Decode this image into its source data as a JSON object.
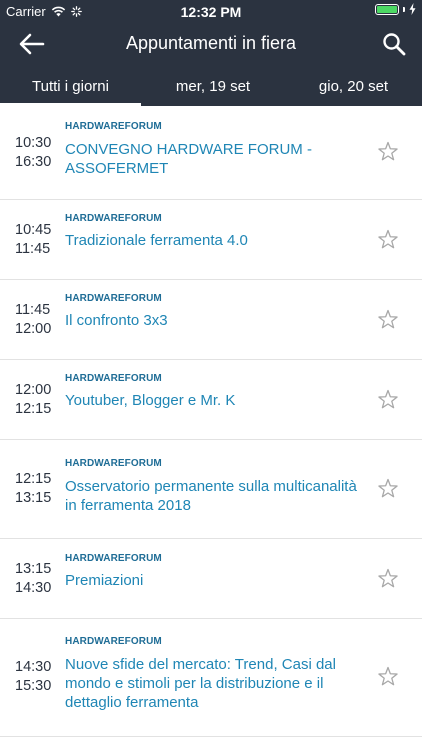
{
  "status_bar": {
    "carrier": "Carrier",
    "time": "12:32 PM",
    "icons": [
      "wifi-icon",
      "loading-spinner-icon",
      "battery-icon",
      "charging-bolt-icon"
    ]
  },
  "header": {
    "title": "Appuntamenti in fiera",
    "icons": [
      "back-arrow-icon",
      "search-icon"
    ]
  },
  "tabs": [
    {
      "label": "Tutti i giorni",
      "selected": true
    },
    {
      "label": "mer, 19 set",
      "selected": false
    },
    {
      "label": "gio, 20 set",
      "selected": false
    }
  ],
  "events": [
    {
      "start": "10:30",
      "end": "16:30",
      "tag": "HARDWAREFORUM",
      "title": "CONVEGNO HARDWARE FORUM - ASSOFERMET",
      "favorite": false
    },
    {
      "start": "10:45",
      "end": "11:45",
      "tag": "HARDWAREFORUM",
      "title": "Tradizionale ferramenta 4.0",
      "favorite": false
    },
    {
      "start": "11:45",
      "end": "12:00",
      "tag": "HARDWAREFORUM",
      "title": "Il confronto 3x3",
      "favorite": false
    },
    {
      "start": "12:00",
      "end": "12:15",
      "tag": "HARDWAREFORUM",
      "title": "Youtuber, Blogger e Mr. K",
      "favorite": false
    },
    {
      "start": "12:15",
      "end": "13:15",
      "tag": "HARDWAREFORUM",
      "title": "Osservatorio permanente sulla multicanalità in ferramenta 2018",
      "favorite": false
    },
    {
      "start": "13:15",
      "end": "14:30",
      "tag": "HARDWAREFORUM",
      "title": "Premiazioni",
      "favorite": false
    },
    {
      "start": "14:30",
      "end": "15:30",
      "tag": "HARDWAREFORUM",
      "title": "Nuove sfide del mercato: Trend, Casi dal mondo e stimoli per la distribuzione e il dettaglio ferramenta",
      "favorite": false
    }
  ],
  "colors": {
    "header_bg": "#2b3340",
    "accent": "#1f86b5",
    "tag": "#1f6d96",
    "time_text": "#2b3340",
    "battery": "#4cd964"
  }
}
